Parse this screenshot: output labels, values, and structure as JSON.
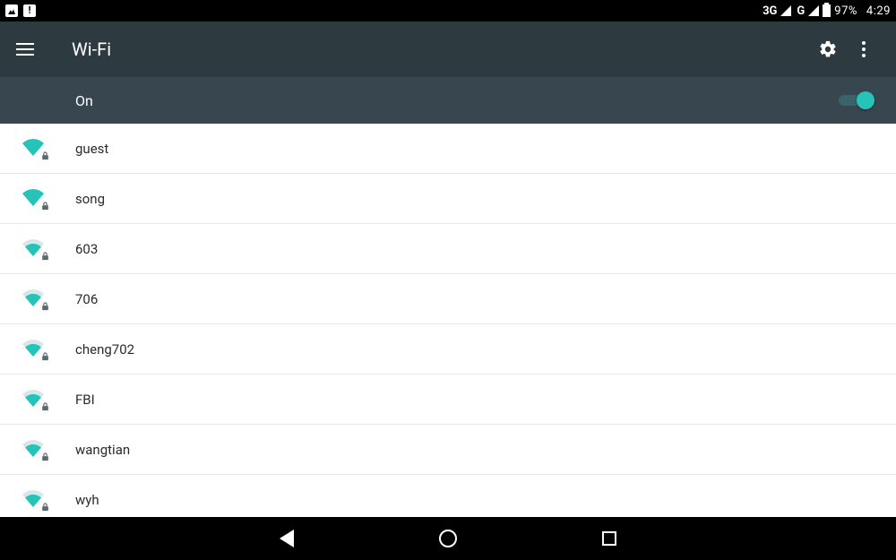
{
  "statusbar": {
    "network_label_1": "3G",
    "network_label_2": "G",
    "battery_pct": "97%",
    "clock": "4:29"
  },
  "appbar": {
    "title": "Wi-Fi"
  },
  "toggle": {
    "label": "On",
    "enabled": true
  },
  "accent_color": "#26c4b8",
  "networks": [
    {
      "ssid": "guest",
      "strength": 4,
      "secured": true
    },
    {
      "ssid": "song",
      "strength": 4,
      "secured": true
    },
    {
      "ssid": "603",
      "strength": 3,
      "secured": true
    },
    {
      "ssid": "706",
      "strength": 3,
      "secured": true
    },
    {
      "ssid": "cheng702",
      "strength": 3,
      "secured": true
    },
    {
      "ssid": "FBI",
      "strength": 3,
      "secured": true
    },
    {
      "ssid": "wangtian",
      "strength": 3,
      "secured": true
    },
    {
      "ssid": "wyh",
      "strength": 3,
      "secured": true
    }
  ]
}
